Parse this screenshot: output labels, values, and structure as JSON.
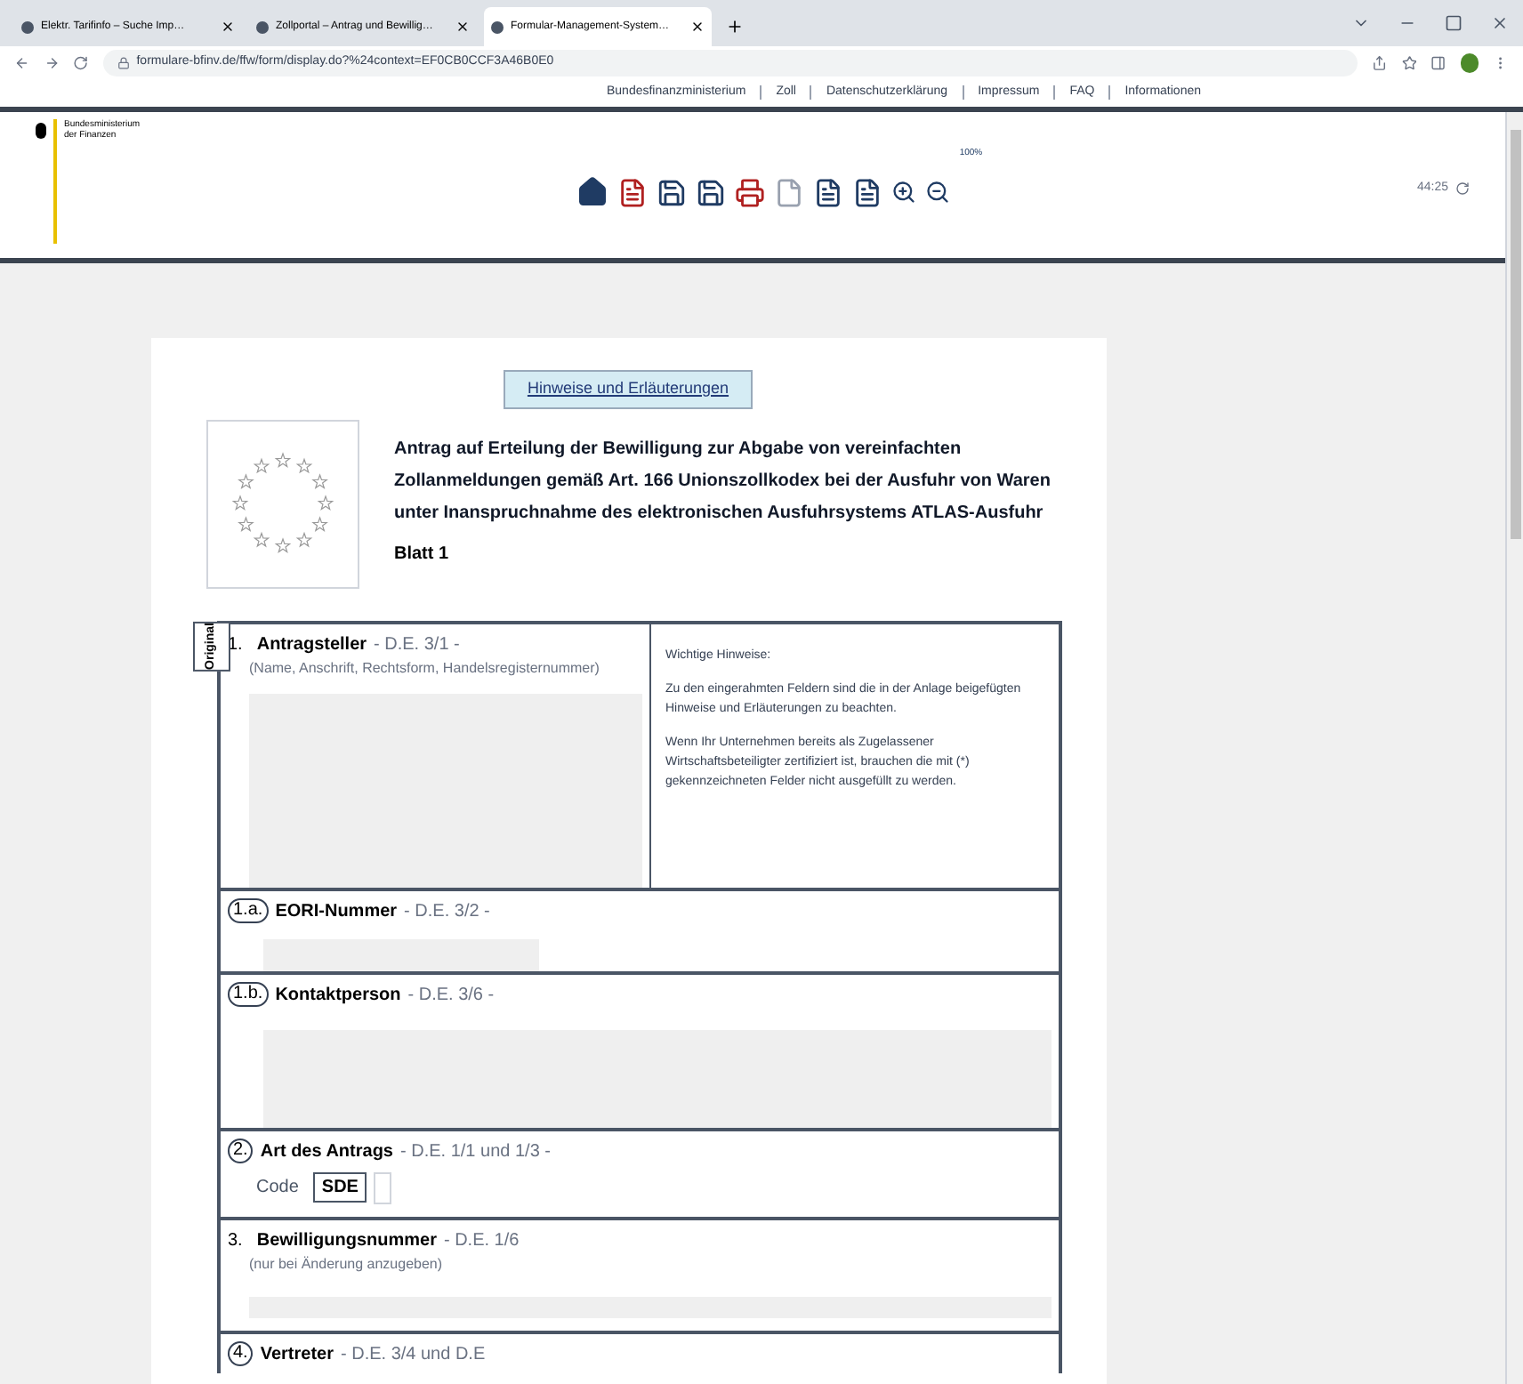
{
  "browser": {
    "tabs": [
      {
        "title": "Elektr. Tarifinfo – Suche Imp…",
        "selected": false
      },
      {
        "title": "Zollportal – Antrag und Bewillig…",
        "selected": false
      },
      {
        "title": "Formular-Management-System…",
        "selected": true
      }
    ],
    "url": "formulare-bfinv.de/ffw/form/display.do?%24context=EF0CB0CCF3A46B0E0"
  },
  "site_nav": [
    "Bundesfinanzministerium",
    "Zoll",
    "Datenschutzerklärung",
    "Impressum",
    "FAQ",
    "Informationen"
  ],
  "header": {
    "logo_text": "Bundesministerium der Finanzen",
    "zoom": "100%",
    "timer": "44:25"
  },
  "form": {
    "help_button": "Hinweise und Erläuterungen",
    "title": "Antrag auf Erteilung der Bewilligung zur Abgabe von vereinfachten Zollanmeldungen gemäß Art. 166 Unionszollkodex bei der Ausfuhr von Waren unter Inanspruchnahme des elektronischen Ausfuhrsystems ATLAS-Ausfuhr",
    "sheet": "Blatt 1",
    "side_tab": "Original",
    "fields": [
      {
        "kind": "main",
        "number": "1.",
        "circled": false,
        "label": "Antragsteller",
        "ref": "- D.E. 3/1 -",
        "hint": "(Name, Anschrift, Rechtsform, Handelsregisternummer)",
        "notes": [
          "Wichtige Hinweise:",
          "Zu den eingerahmten Feldern sind die in der Anlage beigefügten Hinweise und Erläuterungen zu beachten.",
          "Wenn Ihr Unternehmen bereits als Zugelassener Wirtschaftsbeteiligter zertifiziert ist, brauchen die mit (*) gekennzeichneten Felder nicht ausgefüllt zu werden."
        ]
      },
      {
        "kind": "short",
        "number": "1.a.",
        "circled": true,
        "label": "EORI-Nummer",
        "ref": "- D.E. 3/2 -"
      },
      {
        "kind": "wide",
        "number": "1.b.",
        "circled": true,
        "label": "Kontaktperson",
        "ref": "- D.E. 3/6 -"
      },
      {
        "kind": "code",
        "number": "2.",
        "circled": true,
        "label": "Art des Antrags",
        "ref": "- D.E. 1/1 und 1/3 -",
        "code_label": "Code",
        "code": "SDE"
      },
      {
        "kind": "line",
        "number": "3.",
        "circled": false,
        "label": "Bewilligungsnummer",
        "ref": "- D.E. 1/6",
        "hint": "(nur bei Änderung anzugeben)"
      },
      {
        "kind": "cut",
        "number": "4.",
        "circled": true,
        "label": "Vertreter",
        "ref": "- D.E. 3/4 und D.E"
      }
    ]
  }
}
